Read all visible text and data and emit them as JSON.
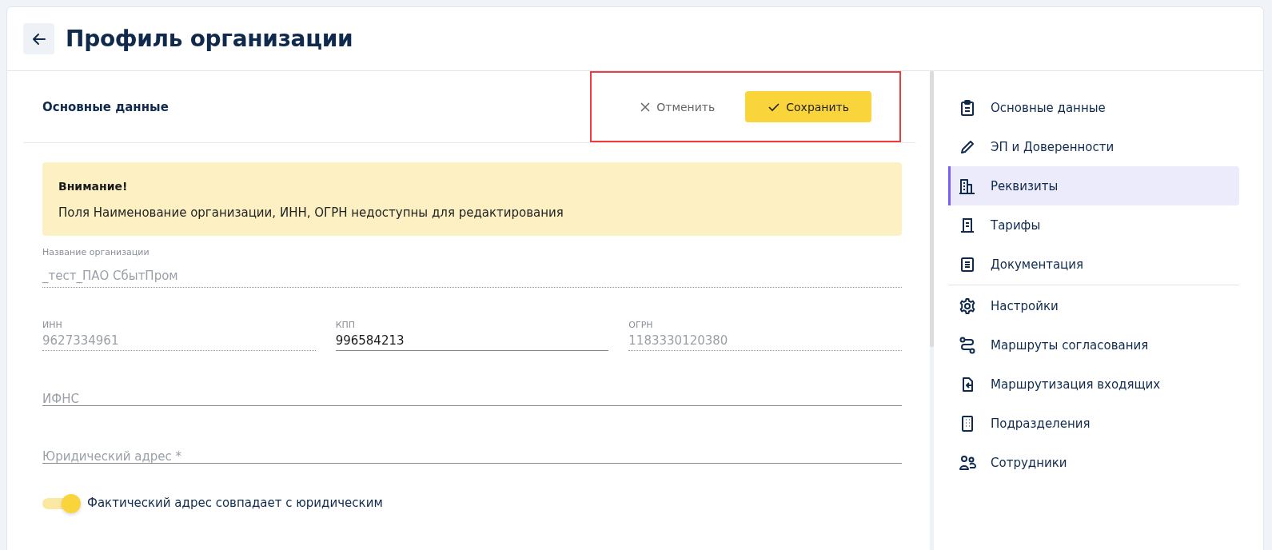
{
  "header": {
    "title": "Профиль организации"
  },
  "section": {
    "title": "Основные данные",
    "highlighted": true,
    "actions": [
      {
        "kind": "cancel",
        "label": "Отменить"
      },
      {
        "kind": "save",
        "label": "Сохранить"
      }
    ]
  },
  "alert": {
    "title": "Внимание!",
    "text": "Поля Наименование организации, ИНН, ОГРН недоступны для редактирования"
  },
  "fields": [
    {
      "label": "Название организации",
      "value": "_тест_ПАО СбытПром",
      "disabled": true
    }
  ],
  "field_row": [
    {
      "label": "ИНН",
      "value": "9627334961",
      "disabled": true
    },
    {
      "label": "КПП",
      "value": "996584213",
      "disabled": false
    },
    {
      "label": "ОГРН",
      "value": "1183330120380",
      "disabled": true
    }
  ],
  "empty_fields": [
    {
      "placeholder": "ИФНС"
    },
    {
      "placeholder": "Юридический адрес *"
    }
  ],
  "toggle": {
    "label": "Фактический адрес совпадает с юридическим",
    "on": true
  },
  "sidebar": {
    "items": [
      {
        "label": "Основные данные",
        "selected": false
      },
      {
        "label": "ЭП и Доверенности",
        "selected": false
      },
      {
        "label": "Реквизиты",
        "selected": true
      },
      {
        "label": "Тарифы",
        "selected": false
      },
      {
        "label": "Документация",
        "selected": false
      },
      {
        "label": "Настройки",
        "selected": false
      },
      {
        "label": "Маршруты согласования",
        "selected": false
      },
      {
        "label": "Маршрутизация входящих",
        "selected": false
      },
      {
        "label": "Подразделения",
        "selected": false
      },
      {
        "label": "Сотрудники",
        "selected": false
      }
    ]
  }
}
